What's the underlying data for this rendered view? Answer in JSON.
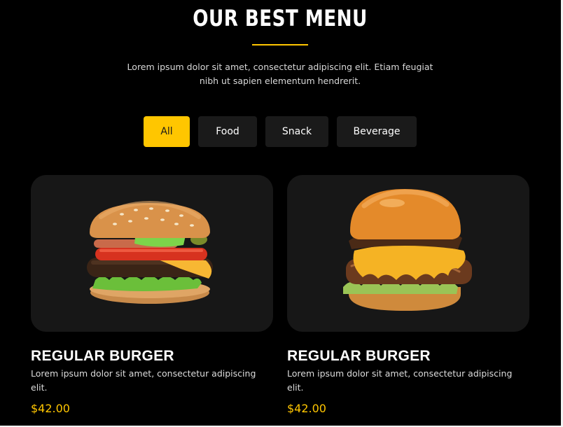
{
  "colors": {
    "accent": "#ffc600",
    "background": "#000000",
    "card_bg": "#171717",
    "button_bg": "#1a1a1a"
  },
  "section": {
    "title": "OUR BEST MENU",
    "intro": "Lorem ipsum dolor sit amet, consectetur adipiscing elit. Etiam feugiat nibh ut sapien elementum hendrerit."
  },
  "filters": [
    {
      "label": "All",
      "active": true
    },
    {
      "label": "Food",
      "active": false
    },
    {
      "label": "Snack",
      "active": false
    },
    {
      "label": "Beverage",
      "active": false
    }
  ],
  "items": [
    {
      "image": "classic-burger-photo",
      "title": "REGULAR BURGER",
      "description": "Lorem ipsum dolor sit amet, consectetur adipiscing elit.",
      "price": "$42.00"
    },
    {
      "image": "cheese-burger-photo",
      "title": "REGULAR BURGER",
      "description": "Lorem ipsum dolor sit amet, consectetur adipiscing elit.",
      "price": "$42.00"
    }
  ]
}
